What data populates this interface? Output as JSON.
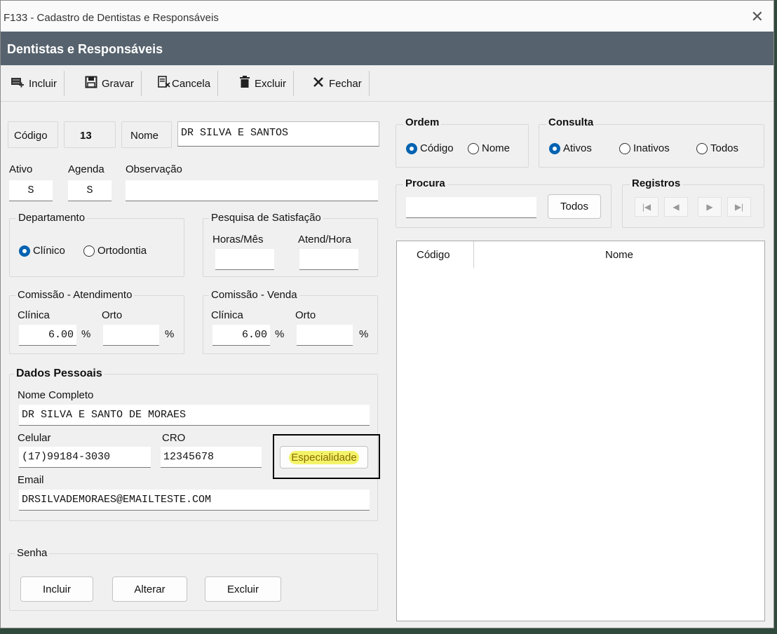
{
  "window": {
    "title": "F133 - Cadastro de Dentistas e Responsáveis",
    "close_glyph": "✕"
  },
  "header": {
    "title": "Dentistas e Responsáveis"
  },
  "toolbar": {
    "incluir": "Incluir",
    "gravar": "Gravar",
    "cancela": "Cancela",
    "excluir": "Excluir",
    "fechar": "Fechar"
  },
  "form": {
    "codigo_label": "Código",
    "codigo_value": "13",
    "nome_label": "Nome",
    "nome_value": "DR SILVA E SANTOS",
    "ativo_label": "Ativo",
    "ativo_value": "S",
    "agenda_label": "Agenda",
    "agenda_value": "S",
    "observacao_label": "Observação",
    "observacao_value": ""
  },
  "departamento": {
    "title": "Departamento",
    "clinico": "Clínico",
    "ortodontia": "Ortodontia",
    "selected": "clinico"
  },
  "pesquisa": {
    "title": "Pesquisa de Satisfação",
    "horas_label": "Horas/Mês",
    "atend_label": "Atend/Hora",
    "horas_value": "",
    "atend_value": ""
  },
  "comissao_atend": {
    "title": "Comissão - Atendimento",
    "clinica_label": "Clínica",
    "orto_label": "Orto",
    "clinica_value": "6.00",
    "orto_value": "",
    "pct": "%"
  },
  "comissao_venda": {
    "title": "Comissão - Venda",
    "clinica_label": "Clínica",
    "orto_label": "Orto",
    "clinica_value": "6.00",
    "orto_value": "",
    "pct": "%"
  },
  "dados": {
    "title": "Dados Pessoais",
    "nome_completo_label": "Nome Completo",
    "nome_completo_value": "DR SILVA E SANTO DE MORAES",
    "celular_label": "Celular",
    "celular_value": "(17)99184-3030",
    "cro_label": "CRO",
    "cro_value": "12345678",
    "especialidade_button": "Especialidade",
    "email_label": "Email",
    "email_value": "DRSILVADEMORAES@EMAILTESTE.COM"
  },
  "senha": {
    "title": "Senha",
    "incluir": "Incluir",
    "alterar": "Alterar",
    "excluir": "Excluir"
  },
  "ordem": {
    "title": "Ordem",
    "codigo": "Código",
    "nome": "Nome",
    "selected": "codigo"
  },
  "consulta": {
    "title": "Consulta",
    "ativos": "Ativos",
    "inativos": "Inativos",
    "todos": "Todos",
    "selected": "ativos"
  },
  "procura": {
    "title": "Procura",
    "value": "",
    "todos_button": "Todos"
  },
  "registros": {
    "title": "Registros",
    "first": "|◀",
    "prev": "◀",
    "next": "▶",
    "last": "▶|"
  },
  "grid": {
    "columns": [
      "Código",
      "Nome"
    ],
    "rows": []
  },
  "colors": {
    "header_bg": "#56636e",
    "radio_selected": "#0063b1",
    "highlight": "#f3f36a"
  }
}
